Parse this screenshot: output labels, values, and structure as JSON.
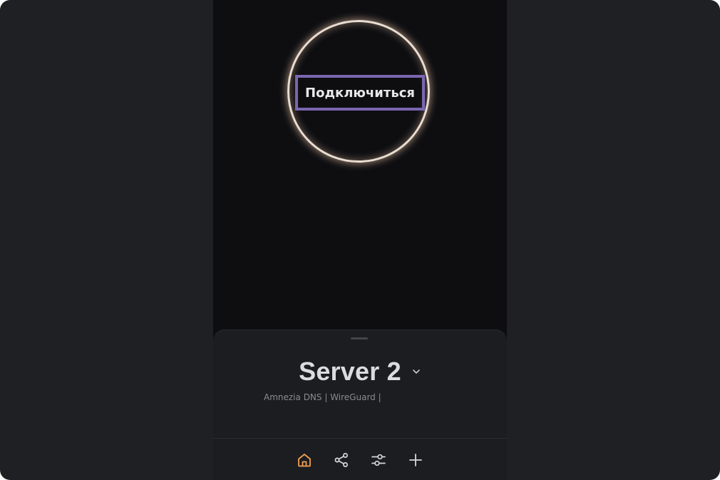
{
  "connect": {
    "label": "Подключиться"
  },
  "server": {
    "name": "Server 2",
    "description": "Amnezia DNS | WireGuard |"
  },
  "nav": {
    "items": [
      {
        "icon": "home-icon",
        "active": true
      },
      {
        "icon": "share-icon",
        "active": false
      },
      {
        "icon": "settings-sliders-icon",
        "active": false
      },
      {
        "icon": "plus-icon",
        "active": false
      }
    ]
  },
  "colors": {
    "background": "#1f2024",
    "phone_background": "#0e0e11",
    "drawer_background": "#1c1d21",
    "focus_outline": "#7a66b0",
    "ring": "#e9ddd2",
    "active_nav": "#f0a050",
    "inactive_nav": "#d8d8dc"
  }
}
